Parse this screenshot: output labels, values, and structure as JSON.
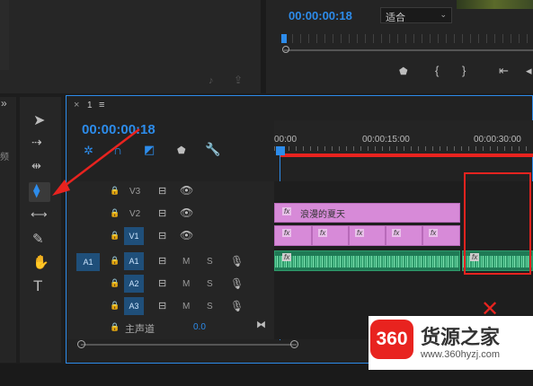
{
  "program_monitor": {
    "timecode": "00:00:00:18",
    "fit_label": "适合"
  },
  "sequence": {
    "tab_close": "×",
    "tab_number": "1",
    "tab_menu": "≡",
    "timecode": "00:00:00:18",
    "ruler": [
      "00:00",
      "00:00:15:00",
      "00:00:30:00"
    ],
    "video_tracks": [
      "V3",
      "V2",
      "V1"
    ],
    "audio_tracks": [
      "A1",
      "A2",
      "A3"
    ],
    "source_a1": "A1",
    "track_m": "M",
    "track_s": "S",
    "master_label": "主声道",
    "master_value": "0.0",
    "clip_fx": "fx",
    "v2_title": "浪漫的夏天",
    "panel_left_text": "频"
  },
  "watermark": {
    "logo": "360",
    "title": "货源之家",
    "url": "www.360hyzj.com"
  },
  "colors": {
    "accent_blue": "#2d8ceb",
    "clip_pink": "#d78ad8",
    "audio_green": "#2f9a6b",
    "annotation_red": "#e8231f"
  }
}
